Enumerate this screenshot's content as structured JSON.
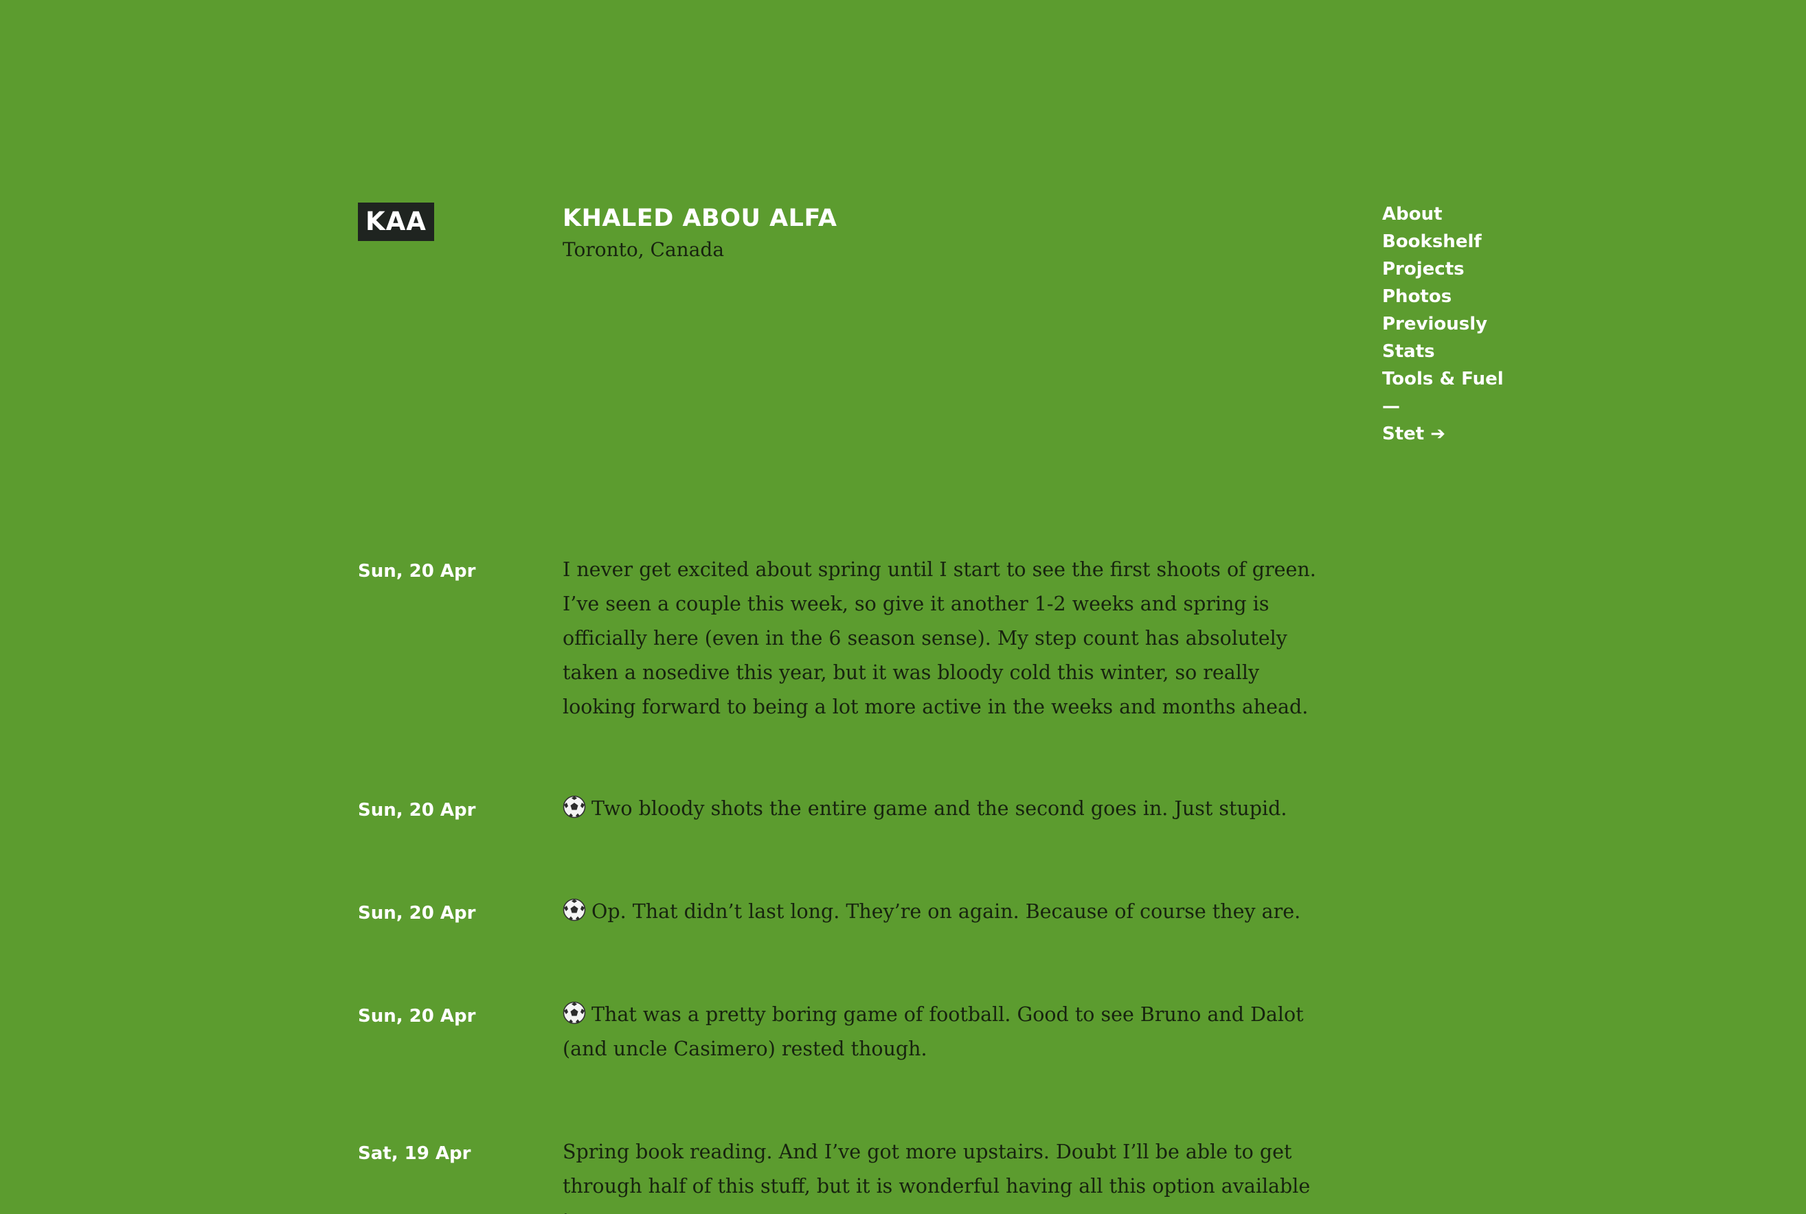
{
  "header": {
    "logo": "KAA",
    "title": "KHALED ABOU ALFA",
    "location": "Toronto, Canada"
  },
  "nav": {
    "items": [
      {
        "label": "About"
      },
      {
        "label": "Bookshelf"
      },
      {
        "label": "Projects"
      },
      {
        "label": "Photos"
      },
      {
        "label": "Previously"
      },
      {
        "label": "Stats"
      },
      {
        "label": "Tools & Fuel"
      }
    ],
    "separator": "—",
    "external": "Stet ➔"
  },
  "posts": [
    {
      "date": "Sun, 20 Apr",
      "icon": "",
      "text": "I never get excited about spring until I start to see the first shoots of green. I’ve seen a couple this week, so give it another 1-2 weeks and spring is officially here (even in the 6 season sense). My step count has absolutely taken a nosedive this year, but it was bloody cold this winter, so really looking forward to being a lot more active in the weeks and months ahead."
    },
    {
      "date": "Sun, 20 Apr",
      "icon": "soccer-ball-icon",
      "text": "Two bloody shots the entire game and the second goes in. Just stupid."
    },
    {
      "date": "Sun, 20 Apr",
      "icon": "soccer-ball-icon",
      "text": "Op. That didn’t last long. They’re on again. Because of course they are."
    },
    {
      "date": "Sun, 20 Apr",
      "icon": "soccer-ball-icon",
      "text": "That was a pretty boring game of football. Good to see Bruno and Dalot (and uncle Casimero) rested though."
    },
    {
      "date": "Sat, 19 Apr",
      "icon": "",
      "text": "Spring book reading. And I’ve got more upstairs. Doubt I’ll be able to get through half of this stuff, but it is wonderful having all this option available to me."
    }
  ],
  "colors": {
    "background": "#5c9c2f",
    "logo_bg": "#1f2420",
    "accent_text": "#ffffff",
    "body_text": "#17230f"
  }
}
